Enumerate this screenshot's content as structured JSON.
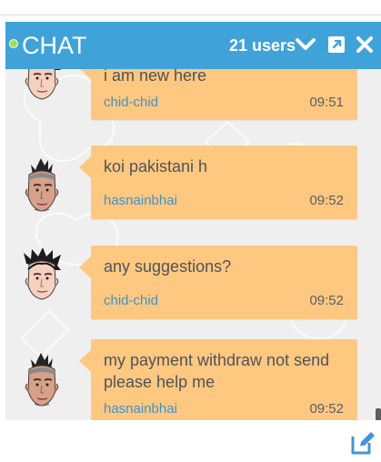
{
  "chat": {
    "title": "CHAT",
    "users_count": "21 users",
    "accent_color": "#3fa3da",
    "bubble_color": "#ffc880",
    "status_color": "#9fe04a",
    "icons": {
      "status": "online-dot",
      "minimize": "chevron-down-icon",
      "popout": "external-window-icon",
      "close": "close-icon",
      "compose": "compose-icon"
    }
  },
  "messages": [
    {
      "text": "i am new here",
      "username": "chid-chid",
      "time": "09:51",
      "avatar": "dark-spiky-hair-avatar"
    },
    {
      "text": "koi pakistani h",
      "username": "hasnainbhai",
      "time": "09:52",
      "avatar": "mohawk-avatar"
    },
    {
      "text": "any suggestions?",
      "username": "chid-chid",
      "time": "09:52",
      "avatar": "dark-spiky-hair-avatar"
    },
    {
      "text": "my payment withdraw not send please help me",
      "username": "hasnainbhai",
      "time": "09:52",
      "avatar": "mohawk-avatar"
    }
  ]
}
